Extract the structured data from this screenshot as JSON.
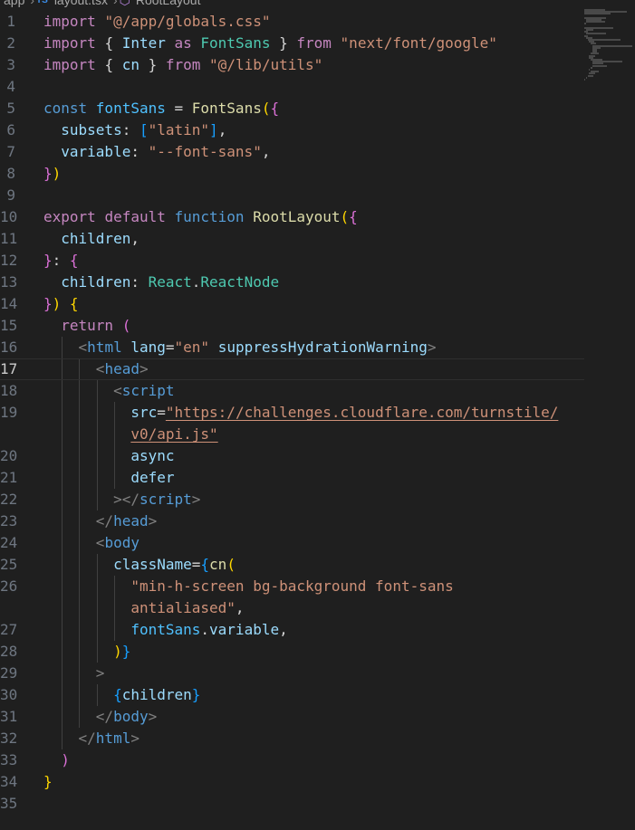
{
  "breadcrumb": [
    "app",
    "layout.tsx",
    "RootLayout"
  ],
  "icons": {
    "file": "ts-file-icon",
    "symbol": "function-symbol-icon",
    "separator": "chevron-right-icon"
  },
  "active_line": 17,
  "lines": [
    {
      "n": "1",
      "t": [
        [
          "kw",
          "import "
        ],
        [
          "st",
          "\"@/app/globals.css\""
        ]
      ]
    },
    {
      "n": "2",
      "t": [
        [
          "kw",
          "import "
        ],
        [
          "cl",
          "{ "
        ],
        [
          "vr",
          "Inter"
        ],
        [
          "kw",
          " as "
        ],
        [
          "ty",
          "FontSans"
        ],
        [
          "cl",
          " } "
        ],
        [
          "kw",
          "from "
        ],
        [
          "st",
          "\"next/font/google\""
        ]
      ]
    },
    {
      "n": "3",
      "t": [
        [
          "kw",
          "import "
        ],
        [
          "cl",
          "{ "
        ],
        [
          "vr",
          "cn"
        ],
        [
          "cl",
          " } "
        ],
        [
          "kw",
          "from "
        ],
        [
          "st",
          "\"@/lib/utils\""
        ]
      ]
    },
    {
      "n": "4",
      "t": []
    },
    {
      "n": "5",
      "t": [
        [
          "kb",
          "const "
        ],
        [
          "cs",
          "fontSans"
        ],
        [
          "cl",
          " = "
        ],
        [
          "fn",
          "FontSans"
        ],
        [
          "b1",
          "("
        ],
        [
          "b2",
          "{"
        ]
      ]
    },
    {
      "n": "6",
      "t": [
        [
          "cl",
          "  "
        ],
        [
          "vr",
          "subsets"
        ],
        [
          "cl",
          ": "
        ],
        [
          "b3",
          "["
        ],
        [
          "st",
          "\"latin\""
        ],
        [
          "b3",
          "]"
        ],
        [
          "cl",
          ","
        ]
      ]
    },
    {
      "n": "7",
      "t": [
        [
          "cl",
          "  "
        ],
        [
          "vr",
          "variable"
        ],
        [
          "cl",
          ": "
        ],
        [
          "st",
          "\"--font-sans\""
        ],
        [
          "cl",
          ","
        ]
      ]
    },
    {
      "n": "8",
      "t": [
        [
          "b2",
          "}"
        ],
        [
          "b1",
          ")"
        ]
      ]
    },
    {
      "n": "9",
      "t": []
    },
    {
      "n": "10",
      "t": [
        [
          "kw",
          "export "
        ],
        [
          "kw",
          "default "
        ],
        [
          "kb",
          "function "
        ],
        [
          "fn",
          "RootLayout"
        ],
        [
          "b1",
          "("
        ],
        [
          "b2",
          "{"
        ]
      ]
    },
    {
      "n": "11",
      "t": [
        [
          "cl",
          "  "
        ],
        [
          "vr",
          "children"
        ],
        [
          "cl",
          ","
        ]
      ]
    },
    {
      "n": "12",
      "t": [
        [
          "b2",
          "}"
        ],
        [
          "cl",
          ": "
        ],
        [
          "b2",
          "{"
        ]
      ]
    },
    {
      "n": "13",
      "t": [
        [
          "cl",
          "  "
        ],
        [
          "vr",
          "children"
        ],
        [
          "cl",
          ": "
        ],
        [
          "ty",
          "React"
        ],
        [
          "cl",
          "."
        ],
        [
          "ty",
          "ReactNode"
        ]
      ]
    },
    {
      "n": "14",
      "t": [
        [
          "b2",
          "}"
        ],
        [
          "b1",
          ")"
        ],
        [
          "cl",
          " "
        ],
        [
          "b1",
          "{"
        ]
      ]
    },
    {
      "n": "15",
      "t": [
        [
          "cl",
          "  "
        ],
        [
          "kw",
          "return "
        ],
        [
          "b2",
          "("
        ]
      ]
    },
    {
      "n": "16",
      "t": [
        [
          "cl",
          "    "
        ],
        [
          "pu",
          "<"
        ],
        [
          "tg",
          "html"
        ],
        [
          "cl",
          " "
        ],
        [
          "vr",
          "lang"
        ],
        [
          "cl",
          "="
        ],
        [
          "st",
          "\"en\""
        ],
        [
          "cl",
          " "
        ],
        [
          "vr",
          "suppressHydrationWarning"
        ],
        [
          "pu",
          ">"
        ]
      ]
    },
    {
      "n": "17",
      "t": [
        [
          "cl",
          "      "
        ],
        [
          "pu",
          "<"
        ],
        [
          "tg",
          "head"
        ],
        [
          "pu",
          ">"
        ]
      ]
    },
    {
      "n": "18",
      "t": [
        [
          "cl",
          "        "
        ],
        [
          "pu",
          "<"
        ],
        [
          "tg",
          "script"
        ]
      ]
    },
    {
      "n": "19",
      "t": [
        [
          "cl",
          "          "
        ],
        [
          "vr",
          "src"
        ],
        [
          "cl",
          "="
        ],
        [
          "stu",
          "\"https://challenges.cloudflare.com/turnstile/"
        ]
      ]
    },
    {
      "n": "",
      "t": [
        [
          "cl",
          "          "
        ],
        [
          "stu",
          "v0/api.js\""
        ]
      ]
    },
    {
      "n": "20",
      "t": [
        [
          "cl",
          "          "
        ],
        [
          "vr",
          "async"
        ]
      ]
    },
    {
      "n": "21",
      "t": [
        [
          "cl",
          "          "
        ],
        [
          "vr",
          "defer"
        ]
      ]
    },
    {
      "n": "22",
      "t": [
        [
          "cl",
          "        "
        ],
        [
          "pu",
          "></"
        ],
        [
          "tg",
          "script"
        ],
        [
          "pu",
          ">"
        ]
      ]
    },
    {
      "n": "23",
      "t": [
        [
          "cl",
          "      "
        ],
        [
          "pu",
          "</"
        ],
        [
          "tg",
          "head"
        ],
        [
          "pu",
          ">"
        ]
      ]
    },
    {
      "n": "24",
      "t": [
        [
          "cl",
          "      "
        ],
        [
          "pu",
          "<"
        ],
        [
          "tg",
          "body"
        ]
      ]
    },
    {
      "n": "25",
      "t": [
        [
          "cl",
          "        "
        ],
        [
          "vr",
          "className"
        ],
        [
          "cl",
          "="
        ],
        [
          "b3",
          "{"
        ],
        [
          "fn",
          "cn"
        ],
        [
          "b1",
          "("
        ]
      ]
    },
    {
      "n": "26",
      "t": [
        [
          "cl",
          "          "
        ],
        [
          "st",
          "\"min-h-screen bg-background font-sans"
        ]
      ]
    },
    {
      "n": "",
      "t": [
        [
          "cl",
          "          "
        ],
        [
          "st",
          "antialiased\""
        ],
        [
          "cl",
          ","
        ]
      ]
    },
    {
      "n": "27",
      "t": [
        [
          "cl",
          "          "
        ],
        [
          "cs",
          "fontSans"
        ],
        [
          "cl",
          "."
        ],
        [
          "vr",
          "variable"
        ],
        [
          "cl",
          ","
        ]
      ]
    },
    {
      "n": "28",
      "t": [
        [
          "cl",
          "        "
        ],
        [
          "b1",
          ")"
        ],
        [
          "b3",
          "}"
        ]
      ]
    },
    {
      "n": "29",
      "t": [
        [
          "cl",
          "      "
        ],
        [
          "pu",
          ">"
        ]
      ]
    },
    {
      "n": "30",
      "t": [
        [
          "cl",
          "        "
        ],
        [
          "b3",
          "{"
        ],
        [
          "vr",
          "children"
        ],
        [
          "b3",
          "}"
        ]
      ]
    },
    {
      "n": "31",
      "t": [
        [
          "cl",
          "      "
        ],
        [
          "pu",
          "</"
        ],
        [
          "tg",
          "body"
        ],
        [
          "pu",
          ">"
        ]
      ]
    },
    {
      "n": "32",
      "t": [
        [
          "cl",
          "    "
        ],
        [
          "pu",
          "</"
        ],
        [
          "tg",
          "html"
        ],
        [
          "pu",
          ">"
        ]
      ]
    },
    {
      "n": "33",
      "t": [
        [
          "cl",
          "  "
        ],
        [
          "b2",
          ")"
        ]
      ]
    },
    {
      "n": "34",
      "t": [
        [
          "b1",
          "}"
        ]
      ]
    },
    {
      "n": "35",
      "t": []
    }
  ]
}
